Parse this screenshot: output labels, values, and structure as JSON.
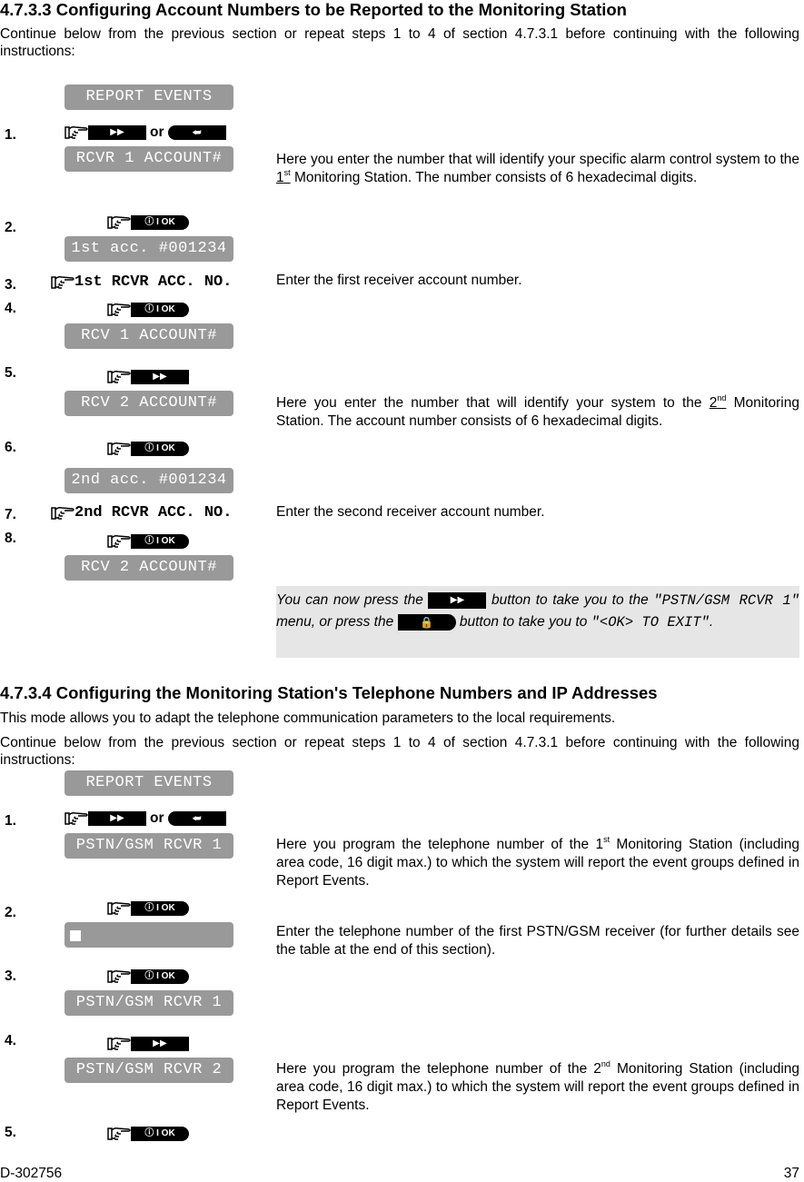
{
  "section1": {
    "title": "4.7.3.3 Configuring Account Numbers to be Reported to the Monitoring Station",
    "intro": "Continue below from the previous section or repeat steps 1 to 4 of section 4.7.3.1 before continuing with the following instructions:",
    "lcd_report_events": "REPORT EVENTS",
    "or_label": "or",
    "steps": [
      {
        "num": "1.",
        "lcd": "RCVR 1 ACCOUNT#",
        "desc_pre": "Here you enter the number that will identify your specific alarm control system to the ",
        "ord": "1",
        "sup": "st",
        "desc_post": " Monitoring Station. The number consists of 6 hexadecimal digits."
      },
      {
        "num": "2.",
        "lcd": "1st acc. #001234"
      },
      {
        "num": "3.",
        "cmd": "1st RCVR ACC. NO.",
        "desc": "Enter the first receiver account number."
      },
      {
        "num": "4.",
        "lcd": "RCV 1 ACCOUNT#"
      },
      {
        "num": "5.",
        "lcd": "RCV 2 ACCOUNT#",
        "desc_pre": "Here you enter the number that will identify your system to the ",
        "ord": "2",
        "sup": "nd",
        "desc_post": " Monitoring Station. The account number consists of 6 hexadecimal digits."
      },
      {
        "num": "6.",
        "lcd": "2nd acc. #001234"
      },
      {
        "num": "7.",
        "cmd": "2nd RCVR ACC. NO.",
        "desc": "Enter the second receiver account number."
      },
      {
        "num": "8.",
        "lcd": "RCV 2 ACCOUNT#"
      }
    ],
    "note": {
      "part1": "You can now press the ",
      "part2": " button to take you to the ",
      "menu1": "\"PSTN/GSM RCVR 1\"",
      "part3": " menu, or press the ",
      "part4": " button to take you to ",
      "menu2": "\"<OK> TO EXIT\"",
      "part5": "."
    }
  },
  "section2": {
    "title": "4.7.3.4 Configuring the Monitoring Station's Telephone Numbers and IP Addresses",
    "intro1": "This mode allows you to adapt the telephone communication parameters to the local requirements.",
    "intro2": "Continue below from the previous section or repeat steps 1 to 4 of section 4.7.3.1 before continuing with the following instructions:",
    "lcd_report_events": "REPORT EVENTS",
    "steps": [
      {
        "num": "1.",
        "lcd": "PSTN/GSM RCVR 1",
        "desc_pre": "Here you program the telephone number of the 1",
        "sup": "st",
        "desc_post": " Monitoring Station (including area code, 16 digit max.) to which the system will report the event groups defined in Report Events."
      },
      {
        "num": "2.",
        "lcd": "",
        "desc": "Enter the telephone number of the first PSTN/GSM receiver (for further details see the table at the end of this section)."
      },
      {
        "num": "3.",
        "lcd": "PSTN/GSM RCVR 1"
      },
      {
        "num": "4.",
        "lcd": "PSTN/GSM RCVR 2",
        "desc_pre": "Here you program the telephone number of the 2",
        "sup": "nd",
        "desc_post": " Monitoring Station (including area code, 16 digit max.) to which the system will report the event groups defined in Report Events."
      },
      {
        "num": "5."
      }
    ]
  },
  "keys": {
    "next": "▶▶",
    "back": "⮨",
    "ok": "ⓘ I OK",
    "lock": "🔒"
  },
  "footer": {
    "doc_id": "D-302756",
    "page": "37"
  }
}
